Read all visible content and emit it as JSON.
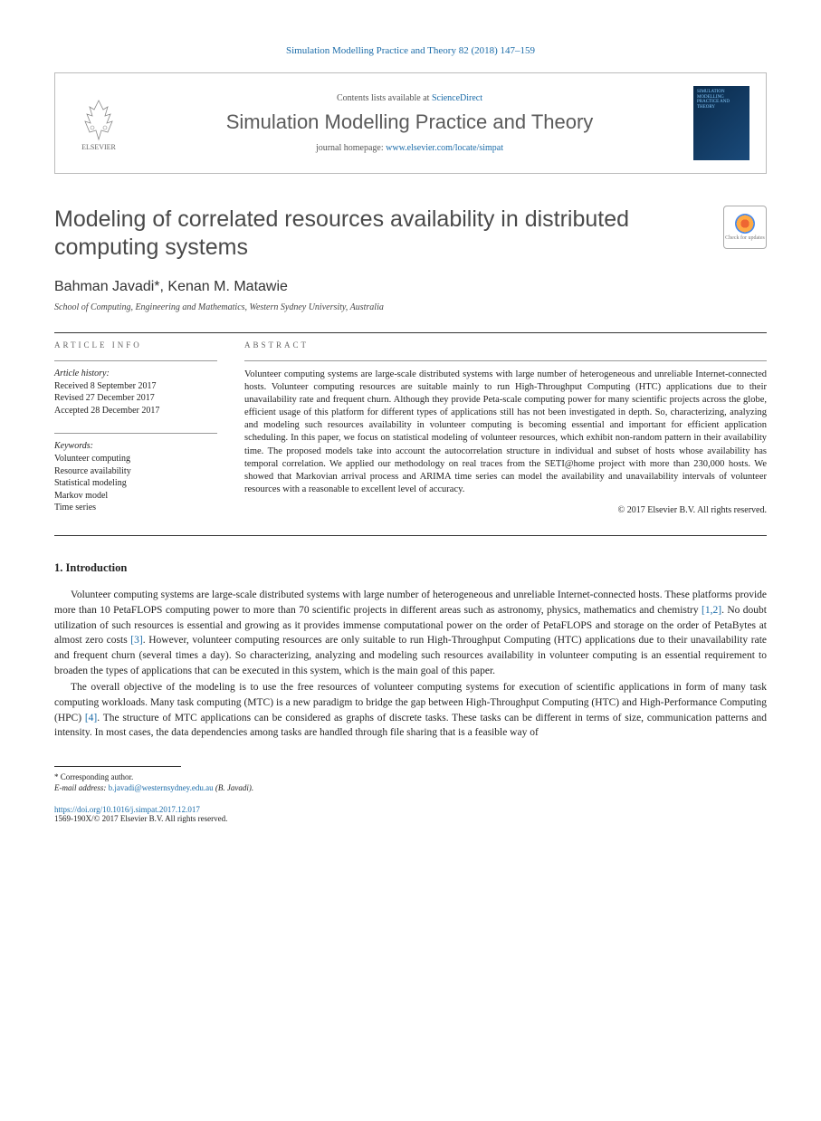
{
  "citation": "Simulation Modelling Practice and Theory 82 (2018) 147–159",
  "header": {
    "contents_prefix": "Contents lists available at ",
    "contents_link": "ScienceDirect",
    "journal": "Simulation Modelling Practice and Theory",
    "homepage_prefix": "journal homepage: ",
    "homepage_url": "www.elsevier.com/locate/simpat",
    "publisher": "ELSEVIER",
    "cover_text": "SIMULATION MODELLING PRACTICE AND THEORY"
  },
  "title": "Modeling of correlated resources availability in distributed computing systems",
  "updates_badge": "Check for updates",
  "authors": "Bahman Javadi*, Kenan M. Matawie",
  "affiliation": "School of Computing, Engineering and Mathematics, Western Sydney University, Australia",
  "info": {
    "label": "ARTICLE INFO",
    "history_label": "Article history:",
    "history": [
      "Received 8 September 2017",
      "Revised 27 December 2017",
      "Accepted 28 December 2017"
    ],
    "keywords_label": "Keywords:",
    "keywords": [
      "Volunteer computing",
      "Resource availability",
      "Statistical modeling",
      "Markov model",
      "Time series"
    ]
  },
  "abstract": {
    "label": "ABSTRACT",
    "text": "Volunteer computing systems are large-scale distributed systems with large number of heterogeneous and unreliable Internet-connected hosts. Volunteer computing resources are suitable mainly to run High-Throughput Computing (HTC) applications due to their unavailability rate and frequent churn. Although they provide Peta-scale computing power for many scientific projects across the globe, efficient usage of this platform for different types of applications still has not been investigated in depth. So, characterizing, analyzing and modeling such resources availability in volunteer computing is becoming essential and important for efficient application scheduling. In this paper, we focus on statistical modeling of volunteer resources, which exhibit non-random pattern in their availability time. The proposed models take into account the autocorrelation structure in individual and subset of hosts whose availability has temporal correlation. We applied our methodology on real traces from the SETI@home project with more than 230,000 hosts. We showed that Markovian arrival process and ARIMA time series can model the availability and unavailability intervals of volunteer resources with a reasonable to excellent level of accuracy.",
    "copyright": "© 2017 Elsevier B.V. All rights reserved."
  },
  "sections": {
    "intro_heading": "1. Introduction",
    "para1_a": "Volunteer computing systems are large-scale distributed systems with large number of heterogeneous and unreliable Internet-connected hosts. These platforms provide more than 10 PetaFLOPS computing power to more than 70 scientific projects in different areas such as astronomy, physics, mathematics and chemistry ",
    "ref1": "[1,2]",
    "para1_b": ". No doubt utilization of such resources is essential and growing as it provides immense computational power on the order of PetaFLOPS and storage on the order of PetaBytes at almost zero costs ",
    "ref2": "[3]",
    "para1_c": ". However, volunteer computing resources are only suitable to run High-Throughput Computing (HTC) applications due to their unavailability rate and frequent churn (several times a day). So characterizing, analyzing and modeling such resources availability in volunteer computing is an essential requirement to broaden the types of applications that can be executed in this system, which is the main goal of this paper.",
    "para2_a": "The overall objective of the modeling is to use the free resources of volunteer computing systems for execution of scientific applications in form of many task computing workloads. Many task computing (MTC) is a new paradigm to bridge the gap between High-Throughput Computing (HTC) and High-Performance Computing (HPC) ",
    "ref3": "[4]",
    "para2_b": ". The structure of MTC applications can be considered as graphs of discrete tasks. These tasks can be different in terms of size, communication patterns and intensity. In most cases, the data dependencies among tasks are handled through file sharing that is a feasible way of"
  },
  "footer": {
    "corresp_marker": "* ",
    "corresp_text": "Corresponding author.",
    "email_label": "E-mail address: ",
    "email": "b.javadi@westernsydney.edu.au",
    "email_suffix": " (B. Javadi).",
    "doi": "https://doi.org/10.1016/j.simpat.2017.12.017",
    "issn": "1569-190X/© 2017 Elsevier B.V. All rights reserved."
  }
}
